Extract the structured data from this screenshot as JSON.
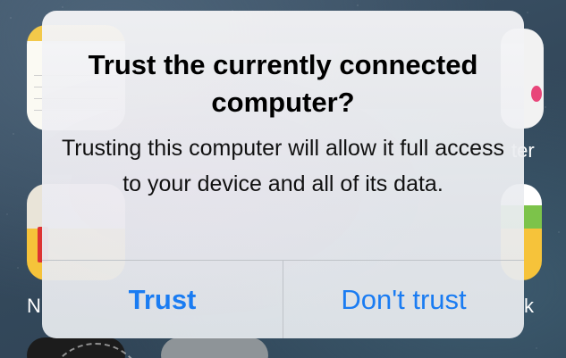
{
  "background": {
    "labels": {
      "right_top_fragment": "ter",
      "left_bottom_fragment": "N",
      "right_bottom_fragment": "k"
    }
  },
  "alert": {
    "title": "Trust the currently connected computer?",
    "message": "Trusting this computer will allow it full access to your device and all of its data.",
    "buttons": {
      "trust": "Trust",
      "dont_trust": "Don't trust"
    },
    "accent_color": "#1a7cf2"
  }
}
